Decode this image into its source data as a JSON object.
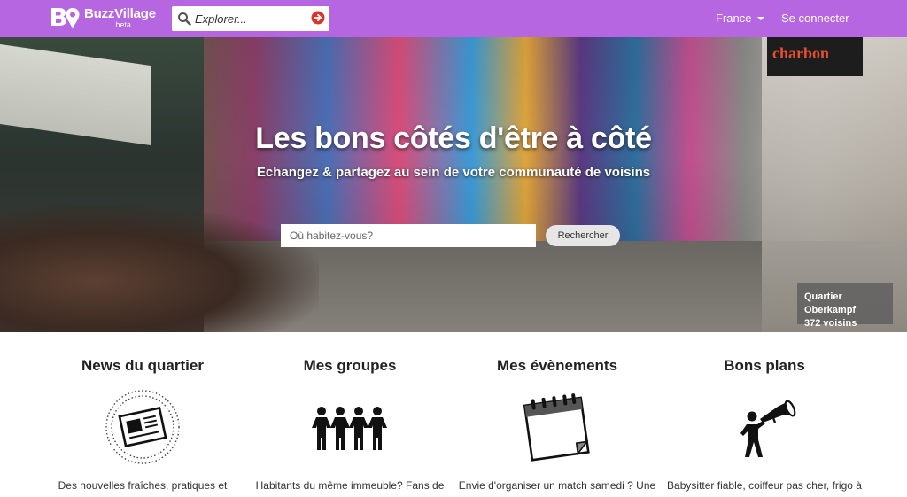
{
  "navbar": {
    "brand_name": "BuzzVillage",
    "brand_badge": "beta",
    "search_placeholder": "Explorer...",
    "country": "France",
    "login": "Se connecter"
  },
  "hero": {
    "title": "Les bons côtés d'être à côté",
    "subtitle": "Echangez & partagez au sein de votre communauté de voisins",
    "address_placeholder": "Où habitez-vous?",
    "search_button": "Rechercher",
    "sign_text": "charbon",
    "badge": {
      "neighborhood": "Quartier Oberkampf",
      "neighbors": "372 voisins"
    }
  },
  "features": [
    {
      "title": "News du quartier",
      "icon": "newspaper-icon",
      "desc": "Des nouvelles fraîches, pratiques et"
    },
    {
      "title": "Mes groupes",
      "icon": "people-chain-icon",
      "desc": "Habitants du même immeuble? Fans de"
    },
    {
      "title": "Mes évènements",
      "icon": "calendar-icon",
      "desc": "Envie d'organiser un match samedi ? Une"
    },
    {
      "title": "Bons plans",
      "icon": "megaphone-person-icon",
      "desc": "Babysitter fiable, coiffeur pas cher, frigo à"
    }
  ],
  "colors": {
    "navbar": "#b566e0",
    "search_go": "#e0302a"
  }
}
